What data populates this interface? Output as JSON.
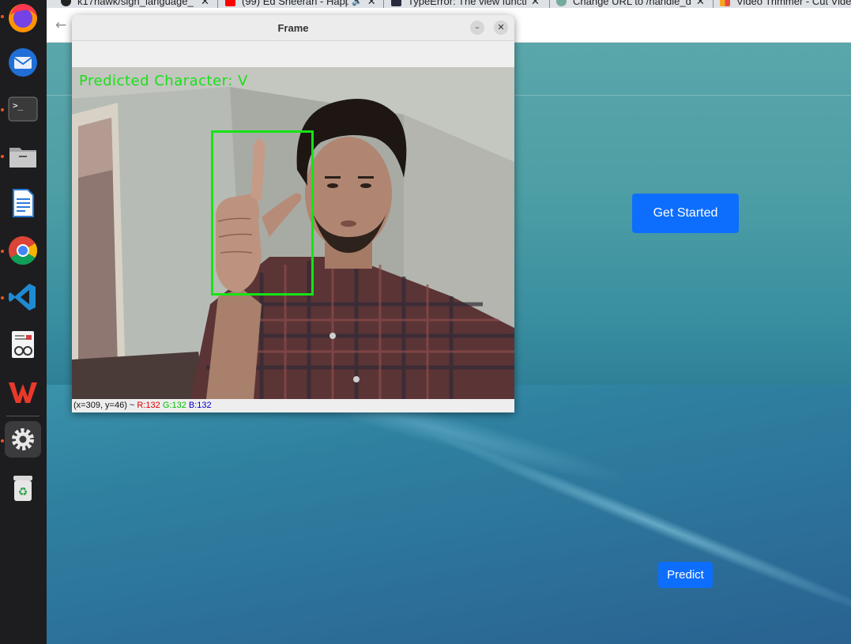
{
  "dock": {
    "apps": [
      {
        "name": "firefox",
        "running": true
      },
      {
        "name": "thunderbird",
        "running": false
      },
      {
        "name": "terminal",
        "running": true
      },
      {
        "name": "files",
        "running": true
      },
      {
        "name": "libreoffice-writer",
        "running": false
      },
      {
        "name": "chrome",
        "running": true
      },
      {
        "name": "vscode",
        "running": true
      },
      {
        "name": "document-viewer",
        "running": false
      },
      {
        "name": "wps-office",
        "running": false
      },
      {
        "name": "settings",
        "running": true
      },
      {
        "name": "trash",
        "running": false
      }
    ]
  },
  "browser": {
    "tabs": [
      {
        "title": "k17hawk/sign_language_",
        "icon": "github-icon"
      },
      {
        "title": "(99) Ed Sheeran - Happ",
        "icon": "youtube-icon"
      },
      {
        "title": "TypeError: The view functi",
        "icon": "terminal-icon"
      },
      {
        "title": "Change URL to /handle_d",
        "icon": "chatgpt-icon"
      },
      {
        "title": "Video Trimmer - Cut Vide",
        "icon": "video-trimmer-icon"
      }
    ],
    "page": {
      "get_started_label": "Get Started",
      "predict_label": "Predict"
    }
  },
  "frame_window": {
    "title": "Frame",
    "prediction_text": "Predicted Character: V",
    "status": {
      "coords": "(x=309, y=46) ~",
      "r": "R:132",
      "g": "G:132",
      "b": "B:132"
    }
  },
  "colors": {
    "dock_bg": "#1d1d1f",
    "button_primary": "#0d6efd",
    "prediction_green": "#18e018"
  }
}
